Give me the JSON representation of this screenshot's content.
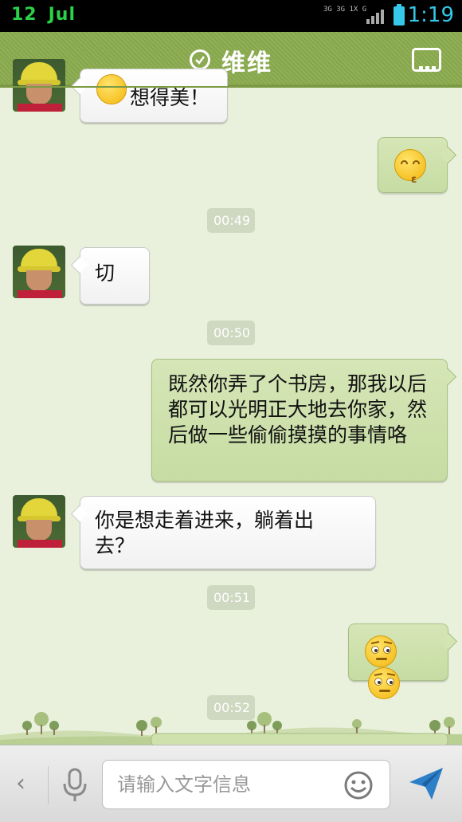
{
  "status_bar": {
    "day": "12",
    "month": "Jul",
    "network_text": "3G 3G 1X G",
    "time": "1:19"
  },
  "header": {
    "title": "维维",
    "verified_icon": "check-circle-icon",
    "menu_icon": "more-dots-icon"
  },
  "messages": [
    {
      "side": "left",
      "text": "想得美！",
      "emoji": "smile-emoji"
    },
    {
      "side": "right",
      "emoji": "kiss-emoji"
    },
    {
      "type": "timestamp",
      "text": "00:49"
    },
    {
      "side": "left",
      "text": "切"
    },
    {
      "type": "timestamp",
      "text": "00:50"
    },
    {
      "side": "right",
      "text": "既然你弄了个书房，那我以后都可以光明正大地去你家，然后做一些偷偷摸摸的事情咯"
    },
    {
      "side": "left",
      "text": "你是想走着进来，躺着出去？"
    },
    {
      "type": "timestamp",
      "text": "00:51"
    },
    {
      "side": "right",
      "emoji": "shocked-emoji x2"
    },
    {
      "type": "timestamp",
      "text": "00:52"
    }
  ],
  "input_bar": {
    "placeholder": "请输入文字信息",
    "back_icon": "chevron-left-icon",
    "voice_icon": "microphone-icon",
    "emoji_icon": "smiley-icon",
    "send_icon": "send-arrow-icon"
  },
  "colors": {
    "header": "#8aab4e",
    "background": "#e9f1dc",
    "bubble_right": "#cfe1ad",
    "bubble_left": "#ffffff",
    "status_time": "#35c8e8",
    "status_date": "#2bd14a"
  }
}
